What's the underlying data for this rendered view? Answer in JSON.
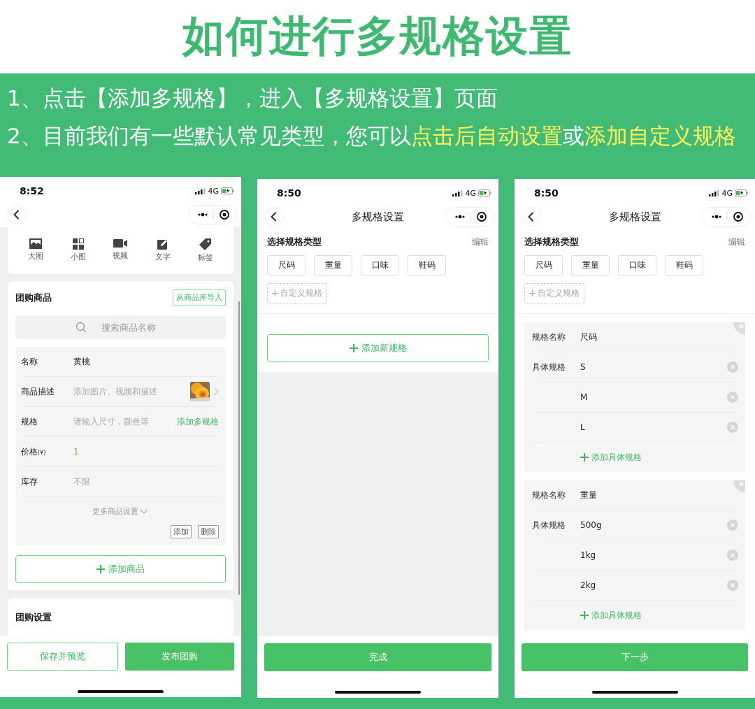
{
  "title": "如何进行多规格设置",
  "steps": [
    {
      "segments": [
        {
          "text": "1、点击【添加多规格】，进入【多规格设置】页面",
          "highlight": false
        }
      ]
    },
    {
      "segments": [
        {
          "text": "2、目前我们有一些默认常见类型，您可以",
          "highlight": false
        },
        {
          "text": "点击后自动设置",
          "highlight": true
        },
        {
          "text": "或",
          "highlight": false
        },
        {
          "text": "添加自定义规格",
          "highlight": true
        }
      ]
    }
  ],
  "screens": [
    {
      "kind": "product_form",
      "time": "8:52",
      "network": "4G",
      "tools": [
        {
          "label": "大图"
        },
        {
          "label": "小图"
        },
        {
          "label": "视频"
        },
        {
          "label": "文字"
        },
        {
          "label": "标签"
        }
      ],
      "section_title": "团购商品",
      "import_button": "从商品库导入",
      "search_placeholder": "搜索商品名称",
      "fields": [
        {
          "label": "名称",
          "value": "黄桃",
          "kind": "value"
        },
        {
          "label": "商品描述",
          "placeholder": "添加图片、视频和描述",
          "kind": "empty",
          "thumbnail": true
        },
        {
          "label": "规格",
          "placeholder": "请输入尺寸，颜色等",
          "kind": "empty",
          "action": "添加多规格"
        },
        {
          "label": "价格",
          "unit": "(¥)",
          "value": "1",
          "kind": "price"
        },
        {
          "label": "库存",
          "placeholder": "不限",
          "kind": "empty"
        }
      ],
      "more": "更多商品设置",
      "item_buttons": [
        "添加",
        "删除"
      ],
      "add_button": "添加商品",
      "settings_title": "团购设置",
      "footer": [
        {
          "label": "保存并预览",
          "kind": "outline"
        },
        {
          "label": "发布团购",
          "kind": "primary"
        }
      ]
    },
    {
      "kind": "spec_types",
      "time": "8:50",
      "network": "4G",
      "nav_title": "多规格设置",
      "heading": "选择规格类型",
      "edit": "编辑",
      "chips": [
        "尺码",
        "重量",
        "口味",
        "鞋码"
      ],
      "custom": "自定义规格",
      "add_new": "添加新规格",
      "footer": [
        {
          "label": "完成",
          "kind": "primary"
        }
      ]
    },
    {
      "kind": "spec_edit",
      "time": "8:50",
      "network": "4G",
      "nav_title": "多规格设置",
      "heading": "选择规格类型",
      "edit": "编辑",
      "chips": [
        "尺码",
        "重量",
        "口味",
        "鞋码"
      ],
      "custom": "自定义规格",
      "groups": [
        {
          "name_label": "规格名称",
          "name": "尺码",
          "values_label": "具体规格",
          "values": [
            "S",
            "M",
            "L"
          ],
          "add": "添加具体规格"
        },
        {
          "name_label": "规格名称",
          "name": "重量",
          "values_label": "具体规格",
          "values": [
            "500g",
            "1kg",
            "2kg"
          ],
          "add": "添加具体规格"
        }
      ],
      "footer": [
        {
          "label": "下一步",
          "kind": "primary"
        }
      ]
    }
  ]
}
